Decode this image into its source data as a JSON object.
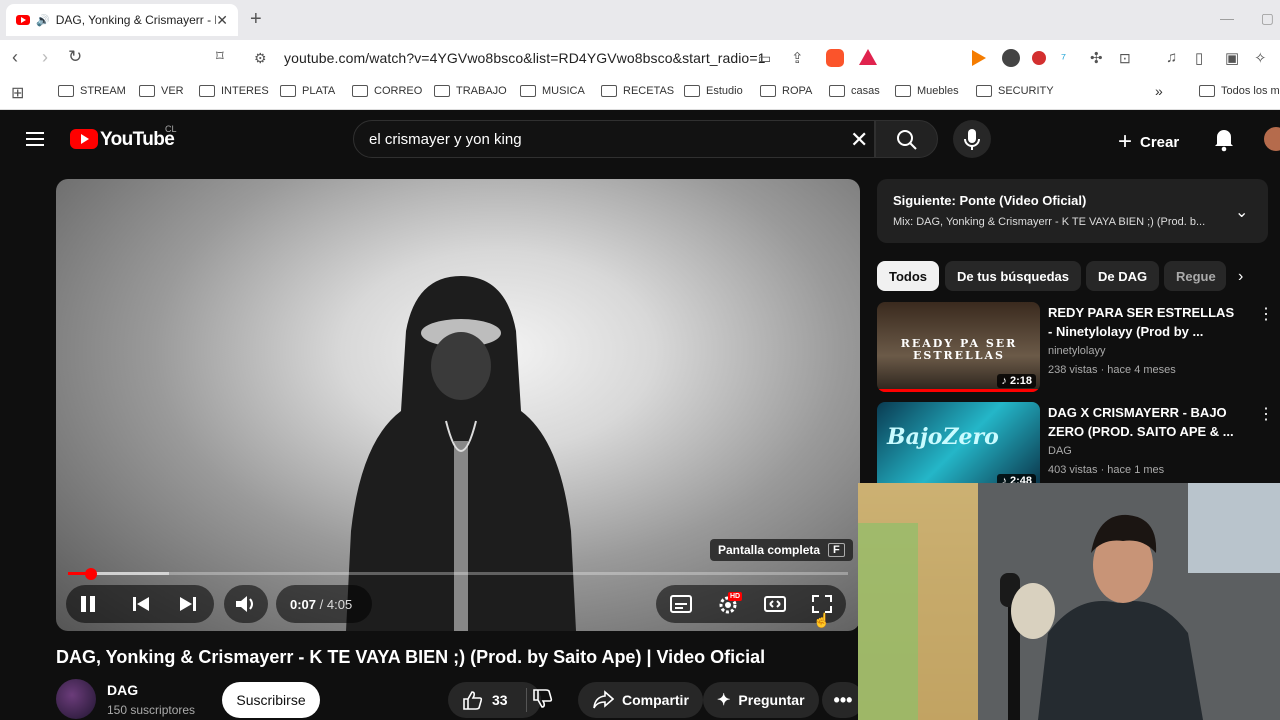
{
  "browser": {
    "tab_title": "DAG, Yonking & Crismayerr - K T",
    "url": "youtube.com/watch?v=4YGVwo8bsco&list=RD4YGVwo8bsco&start_radio=1",
    "bookmarks": [
      "STREAM",
      "VER",
      "INTERES",
      "PLATA",
      "CORREO",
      "TRABAJO",
      "MUSICA",
      "RECETAS",
      "Estudio",
      "ROPA",
      "casas",
      "Muebles",
      "SECURITY"
    ],
    "bookmarks_more": "»",
    "bookmarks_other": "Todos los m"
  },
  "yt": {
    "logo_text": "YouTube",
    "country": "CL",
    "search_query": "el crismayer y yon king",
    "create_label": "Crear"
  },
  "player": {
    "tooltip": "Pantalla completa",
    "tooltip_key": "F",
    "current_time": "0:07",
    "separator": " / ",
    "duration": "4:05",
    "played_fraction": 0.03,
    "buffered_fraction": 0.13,
    "hd_badge": "HD"
  },
  "video": {
    "title": "DAG, Yonking & Crismayerr - K TE VAYA BIEN ;) (Prod. by Saito Ape) | Video Oficial",
    "channel": "DAG",
    "subscribers": "150 suscriptores",
    "subscribe_label": "Suscribirse",
    "likes": "33",
    "share_label": "Compartir",
    "ask_label": "Preguntar"
  },
  "sidebar": {
    "next_title": "Siguiente: Ponte (Video Oficial)",
    "next_subtitle": "Mix: DAG, Yonking & Crismayerr - K TE VAYA BIEN ;) (Prod. b...",
    "chips": [
      "Todos",
      "De tus búsquedas",
      "De DAG",
      "Regue"
    ],
    "related": [
      {
        "title": "REDY PARA SER ESTRELLAS - Ninetylolayy (Prod by ...",
        "channel": "ninetylolayy",
        "meta": "238 vistas · hace 4 meses",
        "duration": "2:18",
        "thumb_text": "READY PA SER ESTRELLAS"
      },
      {
        "title": "DAG X CRISMAYERR  - BAJO ZERO (PROD. SAITO APE & ...",
        "channel": "DAG",
        "meta": "403 vistas · hace 1 mes",
        "duration": "2:48",
        "thumb_text": "BajoZero"
      }
    ]
  },
  "colors": {
    "brand": "#ff0000",
    "bg": "#0f0f0f",
    "chip": "#272727"
  }
}
